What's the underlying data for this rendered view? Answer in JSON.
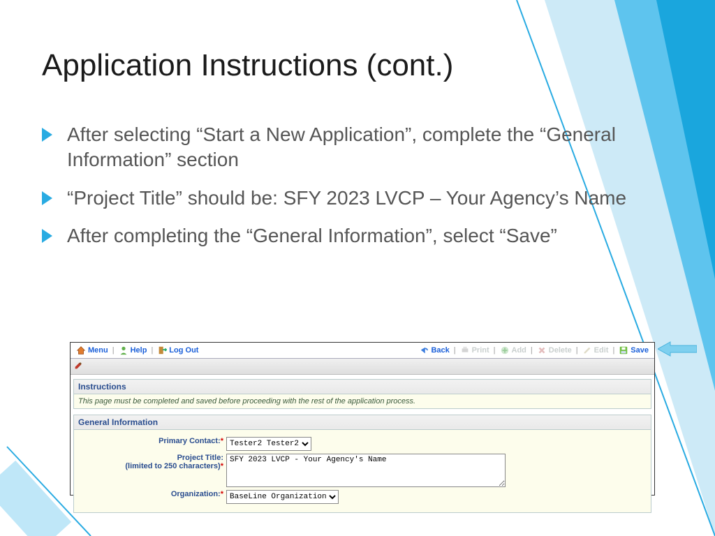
{
  "slide": {
    "title": "Application Instructions (cont.)",
    "bullets": [
      "After selecting “Start a New Application”, complete the “General Information” section",
      "“Project Title” should be: SFY 2023 LVCP – Your Agency’s Name",
      "After completing the “General Information”, select “Save”"
    ]
  },
  "toolbar": {
    "left": {
      "menu": "Menu",
      "help": "Help",
      "logout": "Log Out"
    },
    "right": {
      "back": "Back",
      "print": "Print",
      "add": "Add",
      "delete": "Delete",
      "edit": "Edit",
      "save": "Save"
    }
  },
  "instructions": {
    "header": "Instructions",
    "note": "This page must be completed and saved before proceeding with the rest of the application process."
  },
  "general_info": {
    "header": "General Information",
    "labels": {
      "primary_contact": "Primary Contact:",
      "project_title": "Project Title:",
      "project_title_limit": "(limited to 250 characters)",
      "organization": "Organization:"
    },
    "values": {
      "primary_contact_selected": "Tester2 Tester2",
      "project_title_text": "SFY 2023 LVCP - Your Agency's Name",
      "organization_selected": "BaseLine Organization"
    }
  },
  "colors": {
    "accent": "#29abe2",
    "link": "#1a5fd9",
    "formlabel": "#2a4d8f",
    "required": "#d40000"
  }
}
